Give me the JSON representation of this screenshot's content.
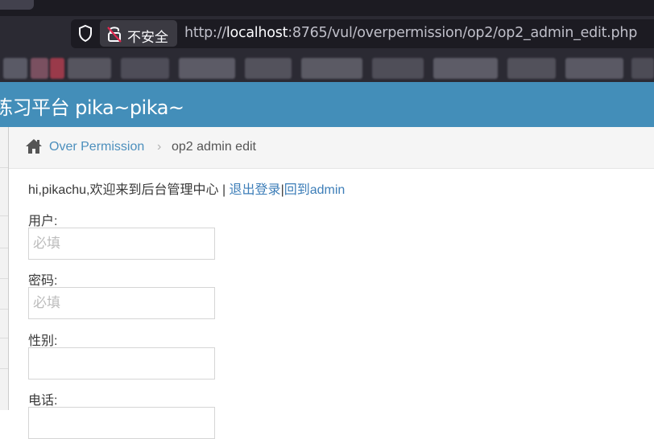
{
  "browser": {
    "security_label": "不安全",
    "url_scheme": "http://",
    "url_host": "localhost",
    "url_rest": ":8765/vul/overpermission/op2/op2_admin_edit.php"
  },
  "site": {
    "title": "练习平台 pika~pika~"
  },
  "breadcrumb": {
    "home_link": "Over Permission",
    "separator": "›",
    "current": "op2 admin edit"
  },
  "main": {
    "greeting": "hi,pikachu,欢迎来到后台管理中心 | ",
    "logout": "退出登录",
    "divider": "|",
    "back_admin": "回到admin",
    "fields": [
      {
        "label": "用户:",
        "placeholder": "必填"
      },
      {
        "label": "密码:",
        "placeholder": "必填"
      },
      {
        "label": "性别:",
        "placeholder": ""
      },
      {
        "label": "电话:",
        "placeholder": ""
      }
    ]
  }
}
